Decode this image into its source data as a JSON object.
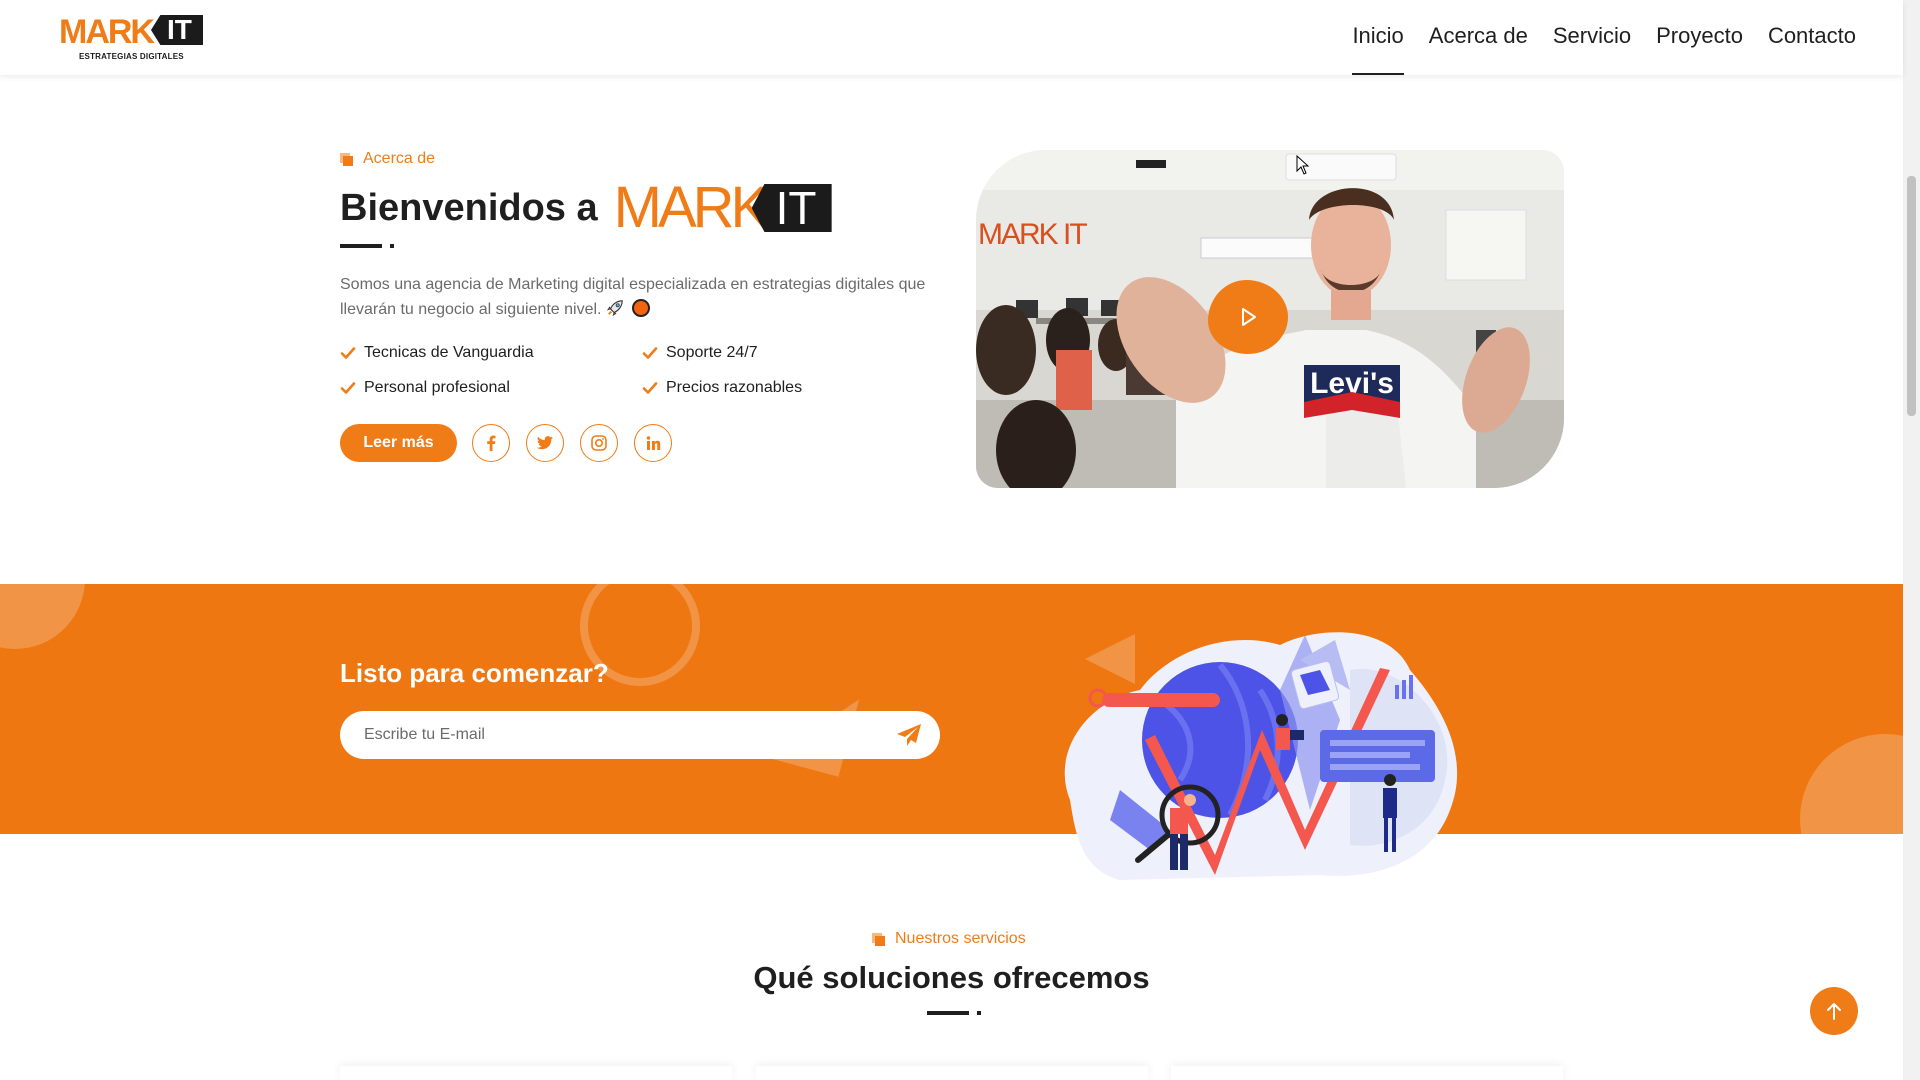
{
  "brand": {
    "logo_text": "MARK",
    "logo_it": "IT",
    "tagline": "ESTRATEGIAS DIGITALES",
    "accent_color": "#f07c18",
    "dark_color": "#1b1b1b"
  },
  "nav": {
    "items": [
      {
        "label": "Inicio",
        "active": true
      },
      {
        "label": "Acerca de",
        "active": false
      },
      {
        "label": "Servicio",
        "active": false
      },
      {
        "label": "Proyecto",
        "active": false
      },
      {
        "label": "Contacto",
        "active": false
      }
    ]
  },
  "about": {
    "eyebrow": "Acerca de",
    "title": "Bienvenidos a",
    "description": "Somos una agencia de Marketing digital especializada en estrategias digitales que llevarán tu negocio al siguiente nivel.",
    "features": [
      "Tecnicas de Vanguardia",
      "Soporte 24/7",
      "Personal profesional",
      "Precios razonables"
    ],
    "read_more_label": "Leer más",
    "social_icons": [
      "facebook-icon",
      "twitter-icon",
      "instagram-icon",
      "linkedin-icon"
    ],
    "video_shirt_text": "Levi's",
    "video_wall_text": "MARK IT"
  },
  "cta": {
    "title": "Listo para comenzar?",
    "email_placeholder": "Escribe tu E-mail",
    "band_color": "#ee7711"
  },
  "services": {
    "eyebrow": "Nuestros servicios",
    "title": "Qué soluciones ofrecemos"
  }
}
